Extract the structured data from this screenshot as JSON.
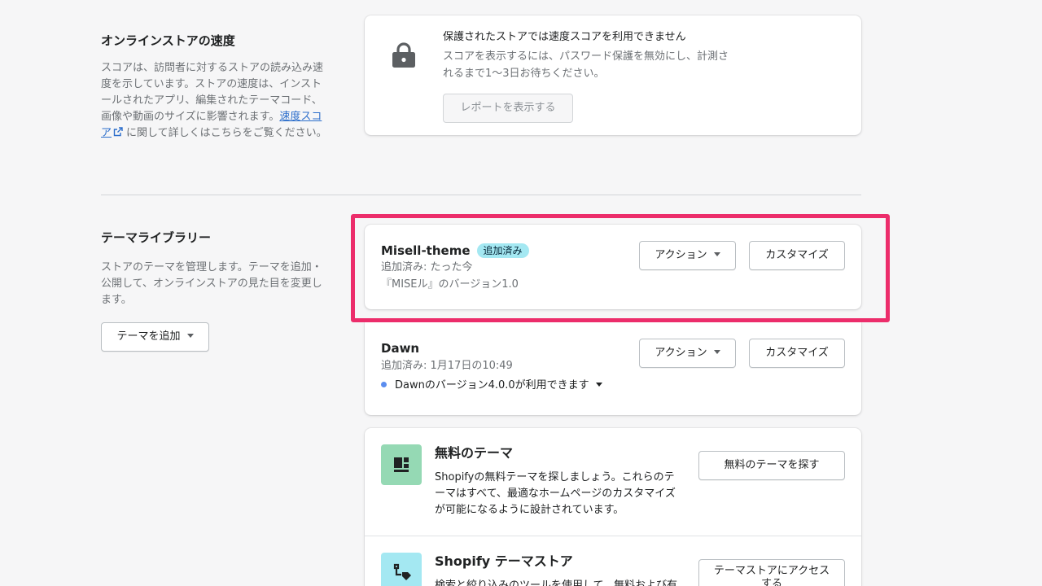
{
  "speed": {
    "title": "オンラインストアの速度",
    "desc_before": "スコアは、訪問者に対するストアの読み込み速度を示しています。ストアの速度は、インストールされたアプリ、編集されたテーマコード、画像や動画のサイズに影響されます。",
    "link_text": "速度スコア",
    "desc_after": "に関して詳しくはこちらをご覧ください。",
    "card_title": "保護されたストアでは速度スコアを利用できません",
    "card_desc": "スコアを表示するには、パスワード保護を無効にし、計測されるまで1〜3日お待ちください。",
    "report_button": "レポートを表示する"
  },
  "library": {
    "title": "テーマライブラリー",
    "desc": "ストアのテーマを管理します。テーマを追加・公開して、オンラインストアの見た目を変更します。",
    "add_button": "テーマを追加",
    "themes": [
      {
        "name": "Misell-theme",
        "badge": "追加済み",
        "added": "追加済み: たった今",
        "version": "『MISEル』のバージョン1.0",
        "action_label": "アクション",
        "customize_label": "カスタマイズ"
      },
      {
        "name": "Dawn",
        "added": "追加済み: 1月17日の10:49",
        "update_notice": "Dawnのバージョン4.0.0が利用できます",
        "action_label": "アクション",
        "customize_label": "カスタマイズ"
      }
    ]
  },
  "free_themes": {
    "title": "無料のテーマ",
    "desc": "Shopifyの無料テーマを探しましょう。これらのテーマはすべて、最適なホームページのカスタマイズが可能になるように設計されています。",
    "button": "無料のテーマを探す"
  },
  "theme_store": {
    "title": "Shopify テーマストア",
    "desc": "検索と絞り込みのツールを使用して、無料および有料のテーマを",
    "button": "テーマストアにアクセスする"
  },
  "colors": {
    "highlight": "#ec2d6b",
    "badge": "#a4e8f2",
    "tile": "#95d9b4",
    "link": "#2c6ecb"
  }
}
